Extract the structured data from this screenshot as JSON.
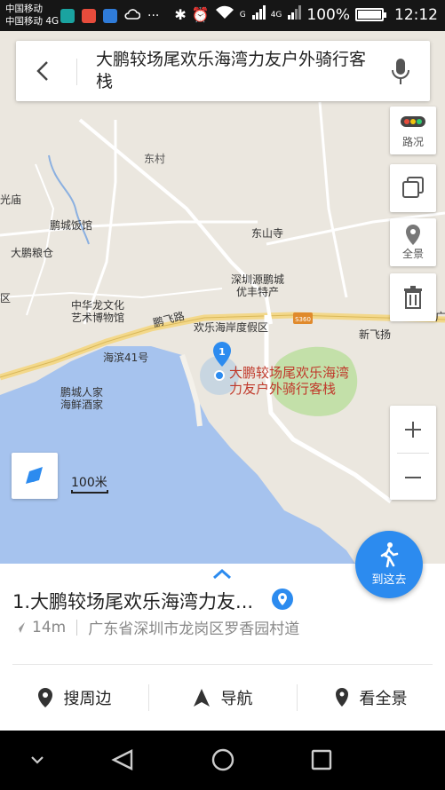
{
  "status_bar": {
    "carrier1": "中国移动",
    "carrier2": "中国移动 4G",
    "more": "···",
    "network_g": "G",
    "network_4g": "4G",
    "battery": "100%",
    "battery_level": 1.0,
    "time": "12:12"
  },
  "search": {
    "query": "大鹏较场尾欢乐海湾力友户外骑行客栈"
  },
  "map_tools": {
    "traffic": "路况",
    "panorama": "全景"
  },
  "map_labels": {
    "dongcun": "东村",
    "guangmiao": "光庙",
    "pengcheng_hotel": "鹏城饭馆",
    "dongshan_temple": "东山寺",
    "dapeng_granary": "大鹏粮仓",
    "shenzhen_yuan_1": "深圳源鹏城",
    "shenzhen_yuan_2": "优丰特产",
    "zhonghualong_1": "中华龙文化",
    "zhonghualong_2": "艺术博物馆",
    "pengfei_road": "鹏飞路",
    "huanlehai_resort": "欢乐海岸度假区",
    "road_badge": "S360",
    "xinfeiyang": "新飞扬",
    "haibin41": "海滨41号",
    "pengcheng_seafood_1": "鹏城人家",
    "pengcheng_seafood_2": "海鲜酒家",
    "left_qu": "区",
    "right_guang": "广",
    "marker_number": "1",
    "selected_poi": "大鹏较场尾欢乐海湾力友户外骑行客栈",
    "scale": "100米"
  },
  "place": {
    "title": "1.大鹏较场尾欢乐海湾力友...",
    "distance": "14m",
    "address": "广东省深圳市龙岗区罗香园村道"
  },
  "goto_button": "到这去",
  "actions": {
    "nearby": "搜周边",
    "navigate": "导航",
    "panorama": "看全景"
  },
  "colors": {
    "water": "#a6c3ee",
    "green": "#c3e0a9",
    "accent_blue": "#2c8bef",
    "poi_red": "#c0392b"
  }
}
